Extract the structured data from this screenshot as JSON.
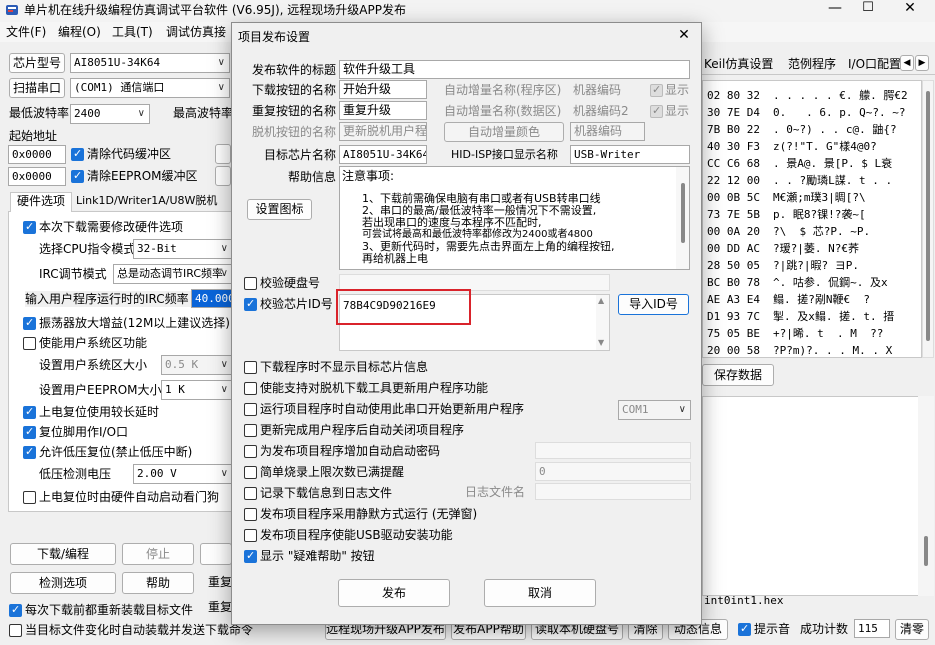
{
  "window": {
    "title": "单片机在线升级编程仿真调试平台软件 (V6.95J), 远程现场升级APP发布"
  },
  "menu": [
    "文件(F)",
    "编程(O)",
    "工具(T)",
    "调试仿真接"
  ],
  "left": {
    "chip_model_label": "芯片型号",
    "chip_model_value": "AI8051U-34K64",
    "scan_port_button": "扫描串口",
    "port_value": "(COM1) 通信端口",
    "min_baud_label": "最低波特率",
    "min_baud_value": "2400",
    "max_baud_label": "最高波特率",
    "start_addr_label": "起始地址",
    "addr1": "0x0000",
    "addr2": "0x0000",
    "clear_code_buffer": "清除代码缓冲区",
    "clear_eeprom_buffer": "清除EEPROM缓冲区",
    "tabs": [
      "硬件选项",
      "Link1D/Writer1A/U8W脱机"
    ],
    "opt_modify_hw": "本次下载需要修改硬件选项",
    "cpu_mode_label": "选择CPU指令模式",
    "cpu_mode_value": "32-Bit",
    "irc_mode_label": "IRC调节模式",
    "irc_mode_value": "总是动态调节IRC频率",
    "irc_freq_label": "输入用户程序运行时的IRC频率",
    "irc_freq_value": "40.000",
    "opt_amp": "振荡器放大增益(12M以上建议选择)",
    "opt_sys_area": "使能用户系统区功能",
    "sys_area_size_label": "设置用户系统区大小",
    "sys_area_size_value": "0.5 K",
    "eeprom_size_label": "设置用户EEPROM大小",
    "eeprom_size_value": "1   K",
    "opt_long_delay": "上电复位使用较长延时",
    "opt_reset_io": "复位脚用作I/O口",
    "opt_low_volt": "允许低压复位(禁止低压中断)",
    "low_volt_label": "低压检测电压",
    "low_volt_value": "2.00 V",
    "opt_watchdog": "上电复位时由硬件自动启动看门狗",
    "download_button": "下载/编程",
    "stop_button": "停止",
    "check_button": "检测选项",
    "help_button": "帮助",
    "reload_label": "重复",
    "reload_each": "每次下载前都重新装载目标文件",
    "reload_on_change": "当目标文件变化时自动装载并发送下载命令"
  },
  "right": {
    "tabs": [
      "Keil仿真设置",
      "范例程序",
      "I/O口配置"
    ],
    "hex_rows": [
      {
        "b": "02 80 32",
        "a": ". . . . . €. 艨. 腭€2"
      },
      {
        "b": "30 7E D4",
        "a": "0.   . 6. p. Q~?. ~?"
      },
      {
        "b": "7B B0 22",
        "a": ". 0~?) . . c@. 鼬{?"
      },
      {
        "b": "40 30 F3",
        "a": "z(?!\"T. G\"樣4@0?"
      },
      {
        "b": "CC C6 68",
        "a": ". 景A@. 景[P. $ L衰"
      },
      {
        "b": "22 12 00",
        "a": ". . ?勵璘L謀. t . ."
      },
      {
        "b": "00 0B 5C",
        "a": "M€瀬;m璞3|晭[?\\"
      },
      {
        "b": "73 7E 5B",
        "a": "p. 眠8?锞!?袭~["
      },
      {
        "b": "00 0A 20",
        "a": "?\\  $ 芯?P. ~P."
      },
      {
        "b": "00 DD AC",
        "a": "?瑷?|萎. N?€荞"
      },
      {
        "b": "28 50 05",
        "a": "?|跳?|暇? ヨP."
      },
      {
        "b": "BC B0 78",
        "a": "^. 咕参. 侃鋼~. 及x"
      },
      {
        "b": "AE A3 E4",
        "a": "鳎. 搓?剐N鞭€  ?"
      },
      {
        "b": "D1 93 7C",
        "a": "掣. 及x鳎. 搓. t. 搢"
      },
      {
        "b": "75 05 BE",
        "a": "+?|晞. t  . M  ??"
      },
      {
        "b": "20 00 58",
        "a": "?P?m)?. . . M. . X"
      }
    ],
    "save_data_button": "保存数据",
    "file_path": "int0int1.hex"
  },
  "bottom": {
    "buttons": [
      "远程现场升级APP发布",
      "发布APP帮助",
      "读取本机硬盘号",
      "清除",
      "动态信息"
    ],
    "beep_label": "提示音",
    "success_label": "成功计数",
    "success_value": "115",
    "clear_button": "清零"
  },
  "dialog": {
    "title": "项目发布设置",
    "close_glyph": "✕",
    "title_label": "发布软件的标题",
    "title_value": "软件升级工具",
    "dl_btn_name_label": "下载按钮的名称",
    "dl_btn_name_value": "开始升级",
    "redl_btn_name_label": "重复按钮的名称",
    "redl_btn_name_value": "重复升级",
    "offline_btn_name_label": "脱机按钮的名称",
    "offline_btn_name_value": "更新脱机用户程",
    "auto_inc_prog_label": "自动增量名称(程序区)",
    "machine_code_label": "机器编码",
    "show_label": "显示",
    "auto_inc_data_label": "自动增量名称(数据区)",
    "machine_code2_label": "机器编码2",
    "show2_label": "显示",
    "auto_inc_color_button": "自动增量颜色",
    "machine_code3_value": "机器编码",
    "target_chip_label": "目标芯片名称",
    "target_chip_value": "AI8051U-34K64",
    "hid_label": "HID-ISP接口显示名称",
    "hid_value": "USB-Writer",
    "help_label": "帮助信息",
    "set_icon_button": "设置图标",
    "help_lines": [
      "注意事项:",
      "1、下载前需确保电脑有串口或者有USB转串口线",
      "2、串口的最高/最低波特率一般情况下不需设置,",
      "   若出现串口的速度与本程序不匹配时,",
      "   可尝试将最高和最低波特率都修改为2400或者4800",
      "3、更新代码时，需要先点击界面左上角的编程按钮,",
      "   再给机器上电"
    ],
    "verify_disk_label": "校验硬盘号",
    "verify_chipid_label": "校验芯片ID号",
    "chip_id_value": "78B4C9D90216E9",
    "import_id_button": "导入ID号",
    "options": [
      {
        "label": "下载程序时不显示目标芯片信息",
        "checked": false
      },
      {
        "label": "使能支持对脱机下载工具更新用户程序功能",
        "checked": false
      },
      {
        "label": "运行项目程序时自动使用此串口开始更新用户程序",
        "checked": false
      },
      {
        "label": "更新完成用户程序后自动关闭项目程序",
        "checked": false
      },
      {
        "label": "为发布项目程序增加自动启动密码",
        "checked": false
      },
      {
        "label": "简单烧录上限次数已满提醒",
        "checked": false
      },
      {
        "label": "记录下载信息到日志文件",
        "checked": false
      },
      {
        "label": "发布项目程序采用静默方式运行 (无弹窗)",
        "checked": false
      },
      {
        "label": "发布项目程序使能USB驱动安装功能",
        "checked": false
      },
      {
        "label": "显示 \"疑难帮助\" 按钮",
        "checked": true
      }
    ],
    "com_value": "COM1",
    "count_value": "0",
    "log_name_label": "日志文件名",
    "publish_button": "发布",
    "cancel_button": "取消"
  },
  "colors": {
    "accent": "#1a73d9",
    "highlight_box": "#d9232b",
    "titlebar": "#f3f3f3"
  }
}
